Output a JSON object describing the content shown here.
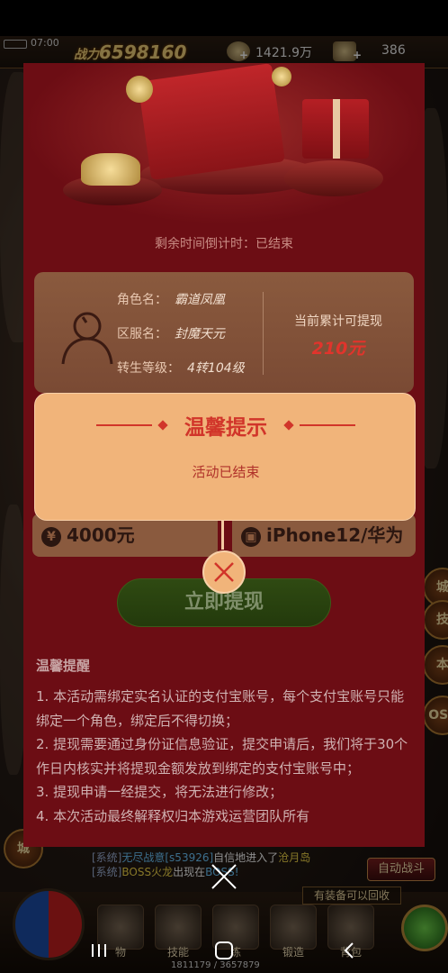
{
  "status_bar": {
    "time": "07:00"
  },
  "hud": {
    "power_prefix": "战力",
    "power_value": "6598160",
    "gold": "1421.9万",
    "gems": "386"
  },
  "side_buttons": {
    "city_left": "城",
    "right_items": [
      "城",
      "技",
      "本",
      "OSS"
    ]
  },
  "chat": {
    "line1": {
      "tag": "[系统]",
      "name": "无尽战意[s53926]",
      "text": "自信地进入了",
      "place": "沧月岛"
    },
    "line2": {
      "tag": "[系统]",
      "name": "BOSS火龙",
      "text": "出现在",
      "place": "BOSS!"
    }
  },
  "auto_battle": "自动战斗",
  "equip_recycle": "有装备可以回收",
  "bottom_menu": [
    "物",
    "技能",
    "练",
    "锻造",
    "背包"
  ],
  "exp_text": "1811179 / 3657879",
  "panel": {
    "countdown": "剩余时间倒计时：已结束",
    "role_label": "角色名：",
    "role_value": "霸道凤凰",
    "server_label": "区服名：",
    "server_value": "封魔天元",
    "level_label": "转生等级：",
    "level_value": "4转104级",
    "total_label": "当前累计可提现",
    "total_value": "210元",
    "options": [
      {
        "icon": "¥",
        "label": "4000元"
      },
      {
        "icon": "▣",
        "label": "iPhone12/华为"
      }
    ],
    "withdraw_button": "立即提现",
    "tips_title": "温馨提醒",
    "tips": [
      "1. 本活动需绑定实名认证的支付宝账号，每个支付宝账号只能绑定一个角色，绑定后不得切换；",
      "2. 提现需要通过身份证信息验证，提交申请后，我们将于30个作日内核实并将提现金额发放到绑定的支付宝账号中；",
      "3. 提现申请一经提交，将无法进行修改；",
      "4. 本次活动最终解释权归本游戏运营团队所有"
    ]
  },
  "dialog": {
    "title": "温馨提示",
    "message": "活动已结束"
  },
  "colors": {
    "panel_bg": "#6c0d14",
    "dialog_bg": "#f1b47a",
    "dialog_accent": "#d1352a",
    "total_value": "#e1342c"
  }
}
